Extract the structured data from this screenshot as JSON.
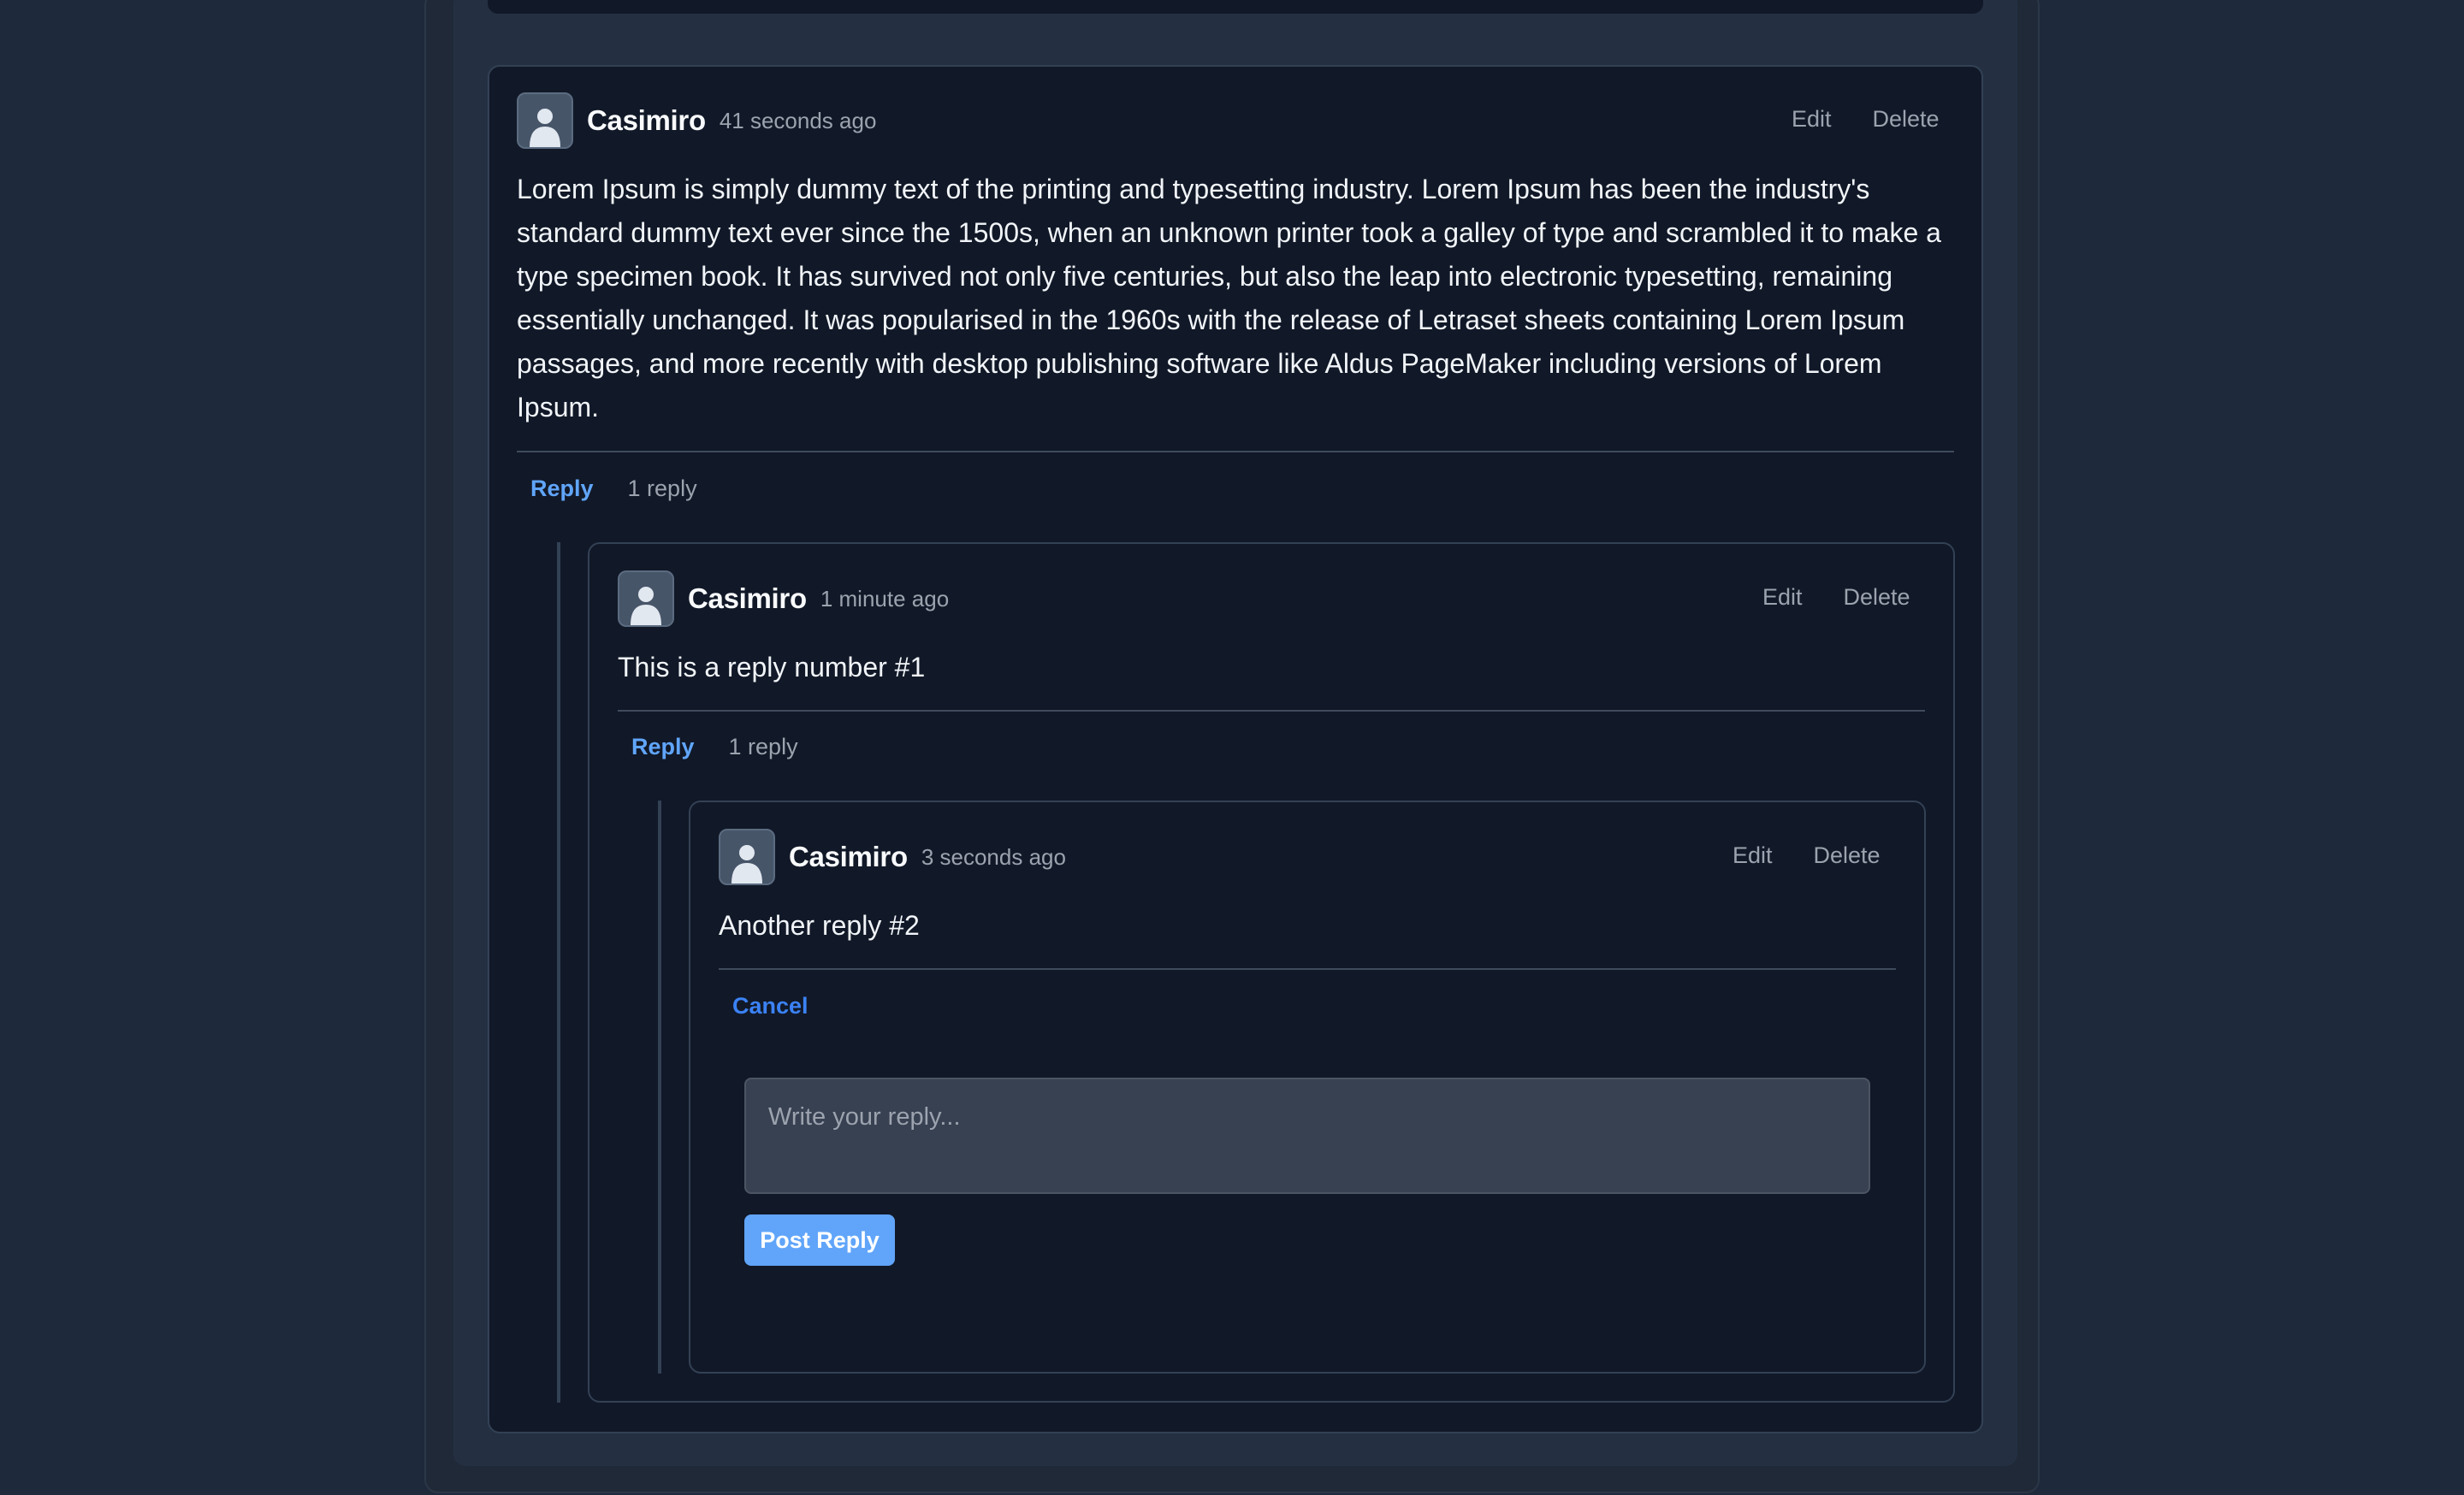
{
  "comments": [
    {
      "author": "Casimiro",
      "time": "41 seconds ago",
      "edit": "Edit",
      "delete": "Delete",
      "text": "Lorem Ipsum is simply dummy text of the printing and typesetting industry. Lorem Ipsum has been the industry's standard dummy text ever since the 1500s, when an unknown printer took a galley of type and scrambled it to make a type specimen book. It has survived not only five centuries, but also the leap into electronic typesetting, remaining essentially unchanged. It was popularised in the 1960s with the release of Letraset sheets containing Lorem Ipsum passages, and more recently with desktop publishing software like Aldus PageMaker including versions of Lorem Ipsum.",
      "reply_label": "Reply",
      "reply_count": "1 reply"
    },
    {
      "author": "Casimiro",
      "time": "1 minute ago",
      "edit": "Edit",
      "delete": "Delete",
      "text": "This is a reply number #1",
      "reply_label": "Reply",
      "reply_count": "1 reply"
    },
    {
      "author": "Casimiro",
      "time": "3 seconds ago",
      "edit": "Edit",
      "delete": "Delete",
      "text": "Another reply #2",
      "cancel_label": "Cancel"
    }
  ],
  "reply_form": {
    "placeholder": "Write your reply...",
    "submit_label": "Post Reply"
  },
  "colors": {
    "page_bg": "#1e293b",
    "card_bg": "#111827",
    "link": "#60a5fa",
    "button": "#60a5fa"
  },
  "icons": [
    "user-avatar-icon"
  ]
}
